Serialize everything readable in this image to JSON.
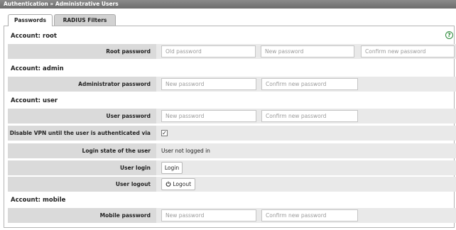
{
  "header": {
    "title": "Authentication » Administrative Users"
  },
  "tabs": [
    {
      "label": "Passwords"
    },
    {
      "label": "RADIUS Filters"
    }
  ],
  "help_icon": "?",
  "sections": {
    "root": {
      "title": "Account: root",
      "row_label": "Root password",
      "old_placeholder": "Old password",
      "new_placeholder": "New password",
      "confirm_placeholder": "Confirm new password"
    },
    "admin": {
      "title": "Account: admin",
      "row_label": "Administrator password",
      "new_placeholder": "New password",
      "confirm_placeholder": "Confirm new password"
    },
    "user": {
      "title": "Account: user",
      "password_label": "User password",
      "new_placeholder": "New password",
      "confirm_placeholder": "Confirm new password",
      "vpn_label": "Disable VPN until the user is authenticated via HTTP",
      "vpn_checked": "✓",
      "state_label": "Login state of the user",
      "state_value": "User not logged in",
      "login_label": "User login",
      "login_button": "Login",
      "logout_label": "User logout",
      "logout_button": "Logout",
      "logout_icon": "power-icon"
    },
    "mobile": {
      "title": "Account: mobile",
      "row_label": "Mobile password",
      "new_placeholder": "New password",
      "confirm_placeholder": "Confirm new password"
    }
  },
  "colors": {
    "accent": "#2c8a3a",
    "label_bg": "#dadada",
    "row_bg": "#e9e9e9"
  }
}
